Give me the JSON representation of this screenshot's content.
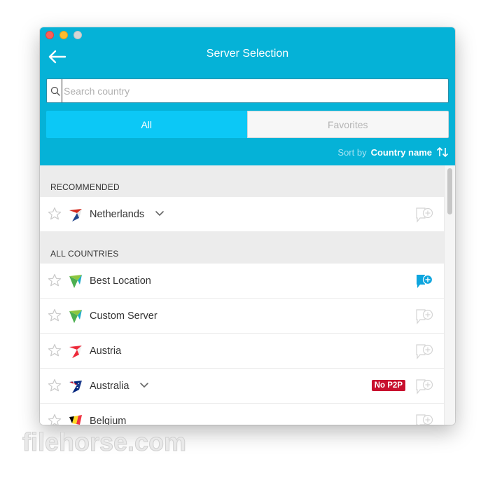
{
  "window": {
    "title": "Server Selection"
  },
  "search": {
    "placeholder": "Search country",
    "value": ""
  },
  "tabs": [
    {
      "label": "All",
      "active": true
    },
    {
      "label": "Favorites",
      "active": false
    }
  ],
  "sort": {
    "label": "Sort by",
    "value": "Country name"
  },
  "sections": {
    "recommended": "RECOMMENDED",
    "all": "ALL COUNTRIES"
  },
  "recommended": [
    {
      "name": "Netherlands",
      "expandable": true
    }
  ],
  "countries": [
    {
      "name": "Best Location",
      "connected": true
    },
    {
      "name": "Custom Server"
    },
    {
      "name": "Austria"
    },
    {
      "name": "Australia",
      "expandable": true,
      "badge": "No P2P"
    },
    {
      "name": "Belgium"
    }
  ],
  "watermark": {
    "text": "filehorse.com"
  },
  "icons": {
    "back": "arrow-left-icon",
    "search": "magnifier-icon",
    "sort": "sort-arrows-icon",
    "favorite": "star-outline-icon",
    "expand": "chevron-down-icon",
    "connect": "location-add-icon"
  },
  "colors": {
    "header": "#05b2d7",
    "tab_active": "#0cc8f6",
    "badge": "#c8102e",
    "connected": "#0ea5de"
  }
}
